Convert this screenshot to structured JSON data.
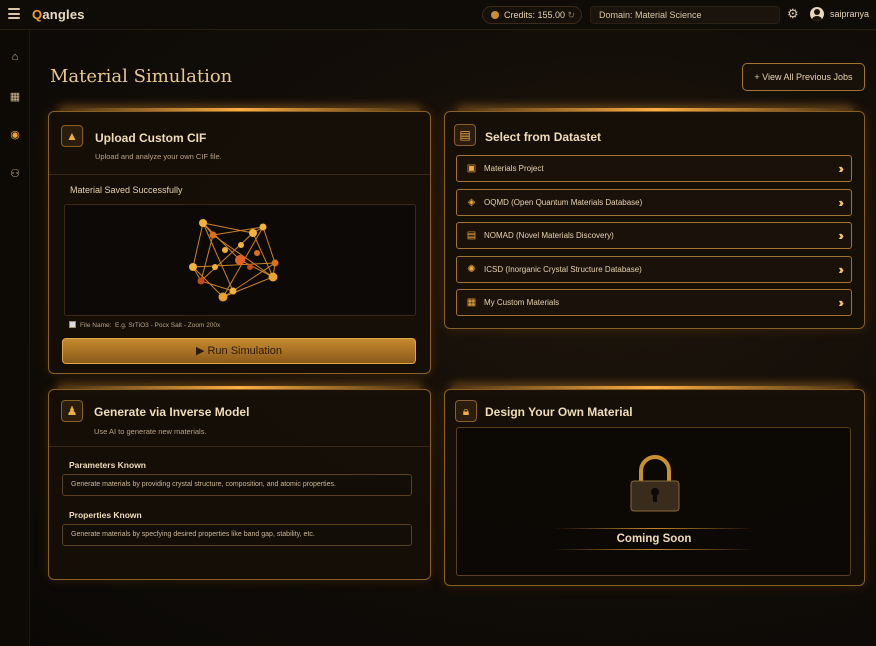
{
  "app": {
    "logo_prefix": "Q",
    "logo_rest": "angles"
  },
  "topbar": {
    "credits_label": "Credits: 155.00",
    "domain_label": "Domain: Material Science",
    "username": "saipranya",
    "icons": {
      "menu": "hamburger-icon",
      "coin": "coin-icon",
      "refresh": "refresh-icon",
      "settings": "gear-icon",
      "user": "user-avatar-icon"
    }
  },
  "sidebar": {
    "items": [
      {
        "icon": "home-icon",
        "glyph": "⌂"
      },
      {
        "icon": "dashboard-icon",
        "glyph": "▦"
      },
      {
        "icon": "globe-icon",
        "glyph": "◉"
      },
      {
        "icon": "nodes-icon",
        "glyph": "⚇"
      }
    ]
  },
  "page": {
    "title": "Material Simulation",
    "view_jobs_label": "+  View All Previous Jobs"
  },
  "upload": {
    "title": "Upload Custom CIF",
    "subtitle": "Upload and analyze your own CIF file.",
    "saved_message": "Material Saved Successfully",
    "file_name_label": "File Name",
    "file_name_placeholder": "E.g. SrTiO3 - Pocx Salt - Zoom 200x",
    "run_label": "Run Simulation"
  },
  "dataset": {
    "title": "Select from Datastet",
    "items": [
      {
        "label": "Materials Project",
        "icon": "cubes-icon",
        "glyph": "▣"
      },
      {
        "label": "OQMD (Open Quantum Materials Database)",
        "icon": "leaf-icon",
        "glyph": "◈"
      },
      {
        "label": "NOMAD (Novel Materials Discovery)",
        "icon": "camera-icon",
        "glyph": "▤"
      },
      {
        "label": "ICSD (Inorganic Crystal Structure Database)",
        "icon": "atom-icon",
        "glyph": "✺"
      },
      {
        "label": "My Custom Materials",
        "icon": "grid-icon",
        "glyph": "▦"
      }
    ]
  },
  "inverse": {
    "title": "Generate via Inverse Model",
    "subtitle": "Use AI to generate new materials.",
    "params_label": "Parameters Known",
    "params_text": "Generate materials by providing crystal structure, composition, and atomic properties.",
    "props_label": "Properties Known",
    "props_text": "Generate materials by specfying desired properties like band gap, stability, etc."
  },
  "design": {
    "title": "Design Your Own Material",
    "coming_soon": "Coming Soon"
  },
  "colors": {
    "accent": "#f0a030",
    "border": "#8a5f25",
    "background": "#120d08"
  }
}
